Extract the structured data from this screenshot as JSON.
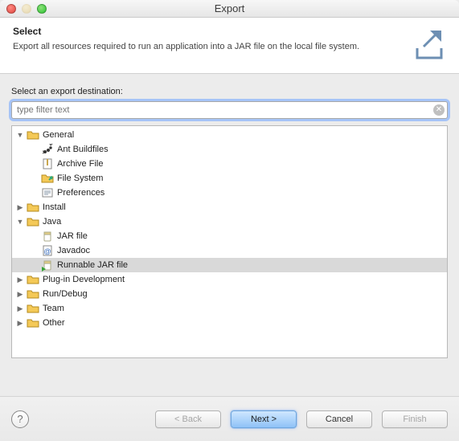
{
  "window": {
    "title": "Export"
  },
  "header": {
    "title": "Select",
    "subtitle": "Export all resources required to run an application into a JAR file on the local file system."
  },
  "body": {
    "label": "Select an export destination:",
    "filter_placeholder": "type filter text",
    "filter_value": ""
  },
  "tree": [
    {
      "depth": 0,
      "twisty": "open",
      "icon": "folder",
      "label": "General",
      "selected": false
    },
    {
      "depth": 1,
      "twisty": "none",
      "icon": "ant",
      "label": "Ant Buildfiles",
      "selected": false
    },
    {
      "depth": 1,
      "twisty": "none",
      "icon": "archive",
      "label": "Archive File",
      "selected": false
    },
    {
      "depth": 1,
      "twisty": "none",
      "icon": "fs",
      "label": "File System",
      "selected": false
    },
    {
      "depth": 1,
      "twisty": "none",
      "icon": "prefs",
      "label": "Preferences",
      "selected": false
    },
    {
      "depth": 0,
      "twisty": "closed",
      "icon": "folder",
      "label": "Install",
      "selected": false
    },
    {
      "depth": 0,
      "twisty": "open",
      "icon": "folder",
      "label": "Java",
      "selected": false
    },
    {
      "depth": 1,
      "twisty": "none",
      "icon": "jar",
      "label": "JAR file",
      "selected": false
    },
    {
      "depth": 1,
      "twisty": "none",
      "icon": "javadoc",
      "label": "Javadoc",
      "selected": false
    },
    {
      "depth": 1,
      "twisty": "none",
      "icon": "runjar",
      "label": "Runnable JAR file",
      "selected": true
    },
    {
      "depth": 0,
      "twisty": "closed",
      "icon": "folder",
      "label": "Plug-in Development",
      "selected": false
    },
    {
      "depth": 0,
      "twisty": "closed",
      "icon": "folder",
      "label": "Run/Debug",
      "selected": false
    },
    {
      "depth": 0,
      "twisty": "closed",
      "icon": "folder",
      "label": "Team",
      "selected": false
    },
    {
      "depth": 0,
      "twisty": "closed",
      "icon": "folder",
      "label": "Other",
      "selected": false
    }
  ],
  "footer": {
    "back": "< Back",
    "next": "Next >",
    "cancel": "Cancel",
    "finish": "Finish",
    "back_enabled": false,
    "next_enabled": true,
    "finish_enabled": false
  },
  "icons": {
    "twisty_open": "▼",
    "twisty_closed": "▶"
  }
}
